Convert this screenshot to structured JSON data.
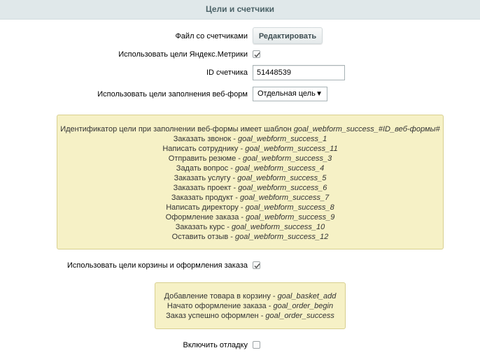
{
  "header": {
    "title": "Цели и счетчики"
  },
  "form": {
    "counters_file_label": "Файл со счетчиками",
    "edit_button_label": "Редактировать",
    "use_metrika_goals_label": "Использовать цели Яндекс.Метрики",
    "use_metrika_goals_checked": true,
    "counter_id_label": "ID счетчика",
    "counter_id_value": "51448539",
    "webform_goals_label": "Использовать цели заполнения веб-форм",
    "webform_goals_value": "Отдельная цель",
    "basket_goals_label": "Использовать цели корзины и оформления заказа",
    "basket_goals_checked": true,
    "debug_label": "Включить отладку",
    "debug_checked": false
  },
  "webform_note": {
    "intro_text": "Идентификатор цели при заполнении веб-формы имеет шаблон ",
    "intro_code": "goal_webform_success_#ID_веб-формы#",
    "items": [
      {
        "name": "Заказать звонок",
        "code": "goal_webform_success_1"
      },
      {
        "name": "Написать сотруднику",
        "code": "goal_webform_success_11"
      },
      {
        "name": "Отправить резюме",
        "code": "goal_webform_success_3"
      },
      {
        "name": "Задать вопрос",
        "code": "goal_webform_success_4"
      },
      {
        "name": "Заказать услугу",
        "code": "goal_webform_success_5"
      },
      {
        "name": "Заказать проект",
        "code": "goal_webform_success_6"
      },
      {
        "name": "Заказать продукт",
        "code": "goal_webform_success_7"
      },
      {
        "name": "Написать директору",
        "code": "goal_webform_success_8"
      },
      {
        "name": "Оформление заказа",
        "code": "goal_webform_success_9"
      },
      {
        "name": "Заказать курс",
        "code": "goal_webform_success_10"
      },
      {
        "name": "Оставить отзыв",
        "code": "goal_webform_success_12"
      }
    ]
  },
  "basket_note": {
    "items": [
      {
        "name": "Добавление товара в корзину",
        "code": "goal_basket_add"
      },
      {
        "name": "Начато оформление заказа",
        "code": "goal_order_begin"
      },
      {
        "name": "Заказ успешно оформлен",
        "code": "goal_order_success"
      }
    ]
  },
  "separator": " - "
}
